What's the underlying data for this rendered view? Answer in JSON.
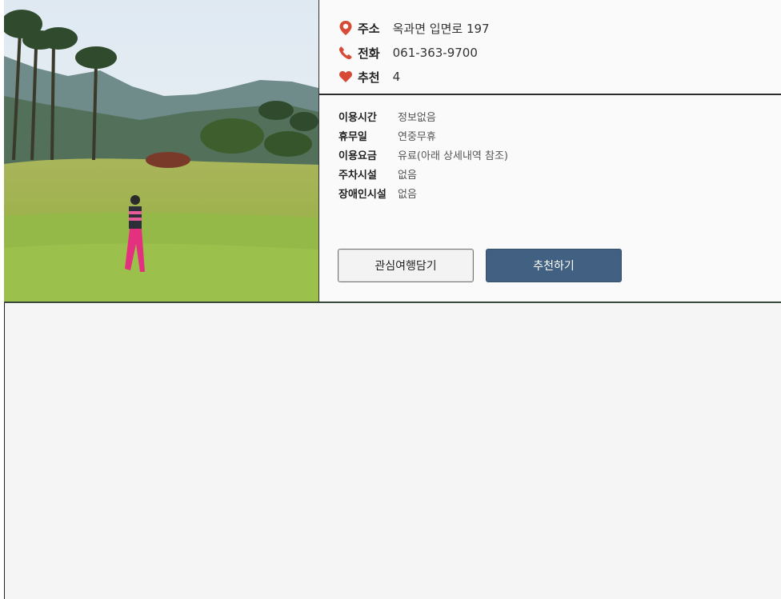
{
  "photo": {
    "description_icon": "golf-course-photo"
  },
  "summary": {
    "address": {
      "icon": "map-pin-icon",
      "label": "주소",
      "value": "옥과면 입면로 197"
    },
    "phone": {
      "icon": "phone-icon",
      "label": "전화",
      "value": "061-363-9700"
    },
    "recommend": {
      "icon": "heart-icon",
      "label": "추천",
      "value": "4"
    }
  },
  "details": [
    {
      "label": "이용시간",
      "value": "정보없음"
    },
    {
      "label": "휴무일",
      "value": "연중무휴"
    },
    {
      "label": "이용요금",
      "value": "유료(아래 상세내역 참조)"
    },
    {
      "label": "주차시설",
      "value": "없음"
    },
    {
      "label": "장애인시설",
      "value": "없음"
    }
  ],
  "buttons": {
    "favorite": "관심여행담기",
    "recommend": "추천하기"
  },
  "colors": {
    "accent_red": "#d64a36",
    "button_blue": "#426182"
  }
}
